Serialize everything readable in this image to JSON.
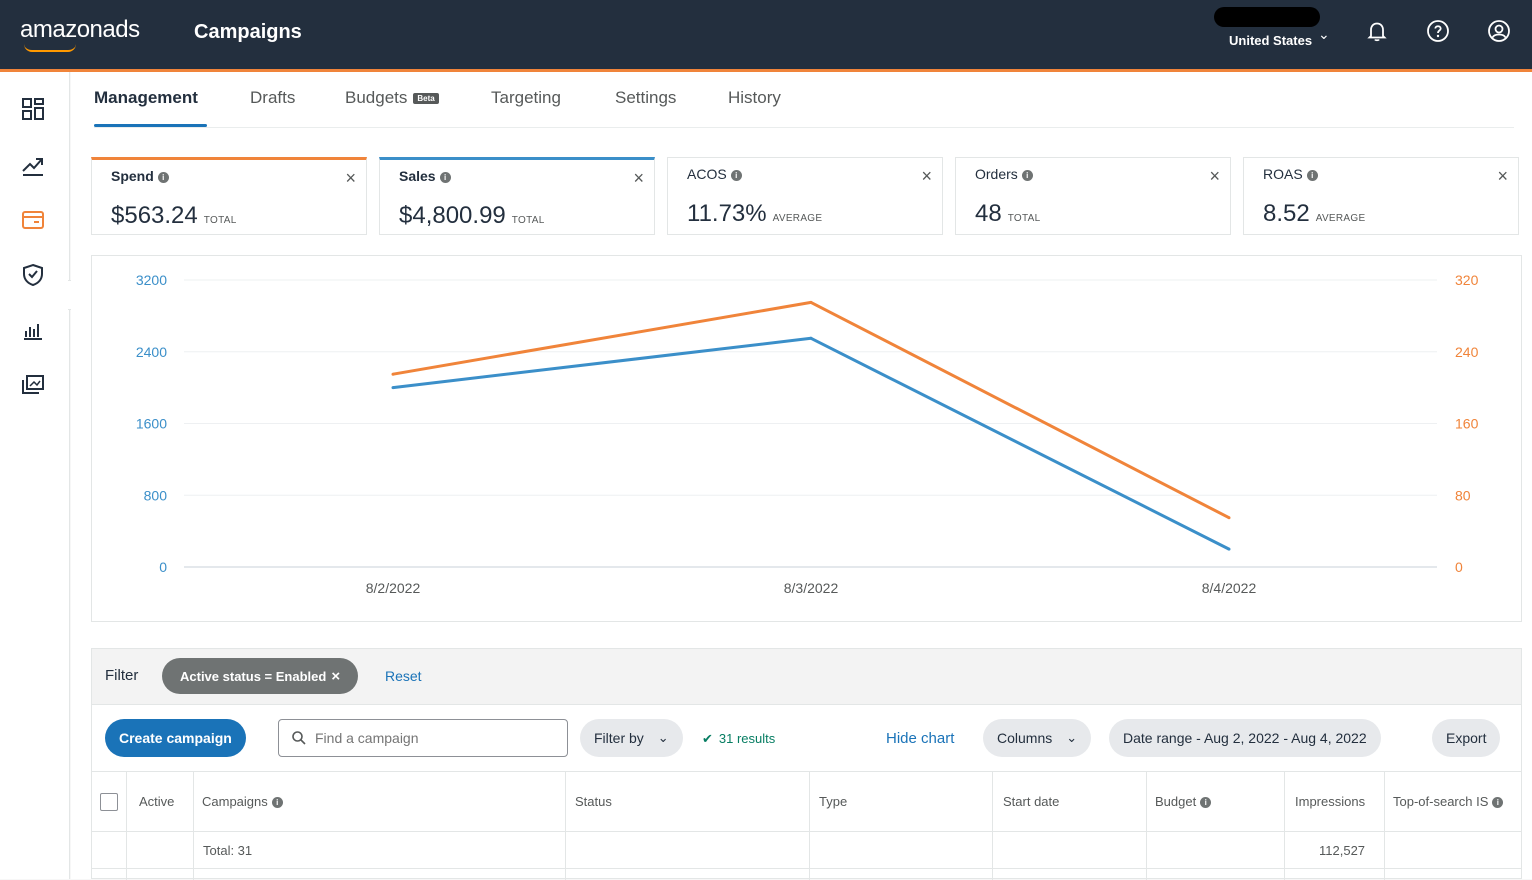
{
  "header": {
    "brand": "amazonads",
    "title": "Campaigns",
    "country": "United States"
  },
  "tabs": [
    {
      "label": "Management",
      "active": true
    },
    {
      "label": "Drafts"
    },
    {
      "label": "Budgets",
      "badge": "Beta"
    },
    {
      "label": "Targeting"
    },
    {
      "label": "Settings"
    },
    {
      "label": "History"
    }
  ],
  "metrics": [
    {
      "name": "Spend",
      "value": "$563.24",
      "label": "TOTAL",
      "color": "#f0843a"
    },
    {
      "name": "Sales",
      "value": "$4,800.99",
      "label": "TOTAL",
      "color": "#3b8fc9"
    },
    {
      "name": "ACOS",
      "value": "11.73%",
      "label": "AVERAGE"
    },
    {
      "name": "Orders",
      "value": "48",
      "label": "TOTAL"
    },
    {
      "name": "ROAS",
      "value": "8.52",
      "label": "AVERAGE"
    }
  ],
  "chart_data": {
    "type": "line",
    "x": [
      "8/2/2022",
      "8/3/2022",
      "8/4/2022"
    ],
    "series": [
      {
        "name": "Sales",
        "axis": "left",
        "color": "#3b8fc9",
        "values": [
          2000,
          2550,
          200
        ]
      },
      {
        "name": "Spend",
        "axis": "right",
        "color": "#f0843a",
        "values": [
          215,
          295,
          55
        ]
      }
    ],
    "y_left": {
      "ticks": [
        "3200",
        "2400",
        "1600",
        "800",
        "0"
      ],
      "lim": [
        0,
        3200
      ],
      "color": "#3b8fc9"
    },
    "y_right": {
      "ticks": [
        "320",
        "240",
        "160",
        "80",
        "0"
      ],
      "lim": [
        0,
        320
      ],
      "color": "#f0843a"
    },
    "grid": true
  },
  "filter": {
    "label": "Filter",
    "chip": "Active status = Enabled",
    "chip_close": "×",
    "reset": "Reset"
  },
  "toolbar": {
    "create": "Create campaign",
    "search_placeholder": "Find a campaign",
    "filter_by": "Filter by",
    "results": "31 results",
    "hide_chart": "Hide chart",
    "columns": "Columns",
    "date_range": "Date range - Aug 2, 2022 - Aug 4, 2022",
    "export": "Export"
  },
  "table": {
    "headers": [
      "Active",
      "Campaigns",
      "Status",
      "Type",
      "Start date",
      "Budget",
      "Impressions",
      "Top-of-search IS"
    ],
    "total_label": "Total: 31",
    "total_impressions": "112,527"
  }
}
